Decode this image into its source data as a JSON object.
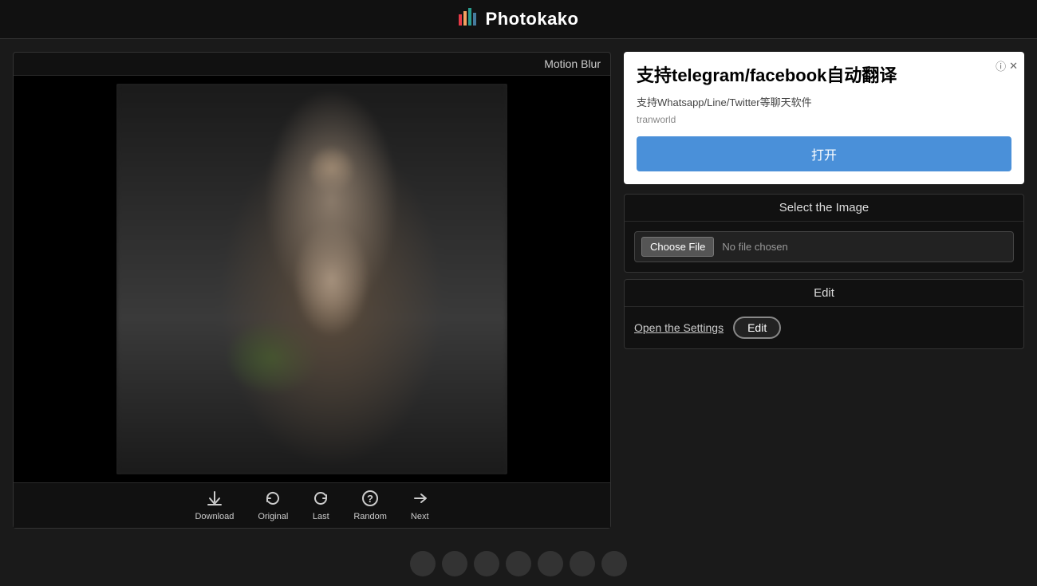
{
  "header": {
    "logo_icon": "📊",
    "site_title": "Photokako"
  },
  "panel": {
    "title": "Motion Blur"
  },
  "toolbar": {
    "items": [
      {
        "icon": "⬇",
        "label": "Download"
      },
      {
        "icon": "↺",
        "label": "Original"
      },
      {
        "icon": "↻",
        "label": "Last"
      },
      {
        "icon": "?",
        "label": "Random"
      },
      {
        "icon": "→",
        "label": "Next"
      }
    ]
  },
  "ad": {
    "title": "支持telegram/facebook自动翻译",
    "subtitle": "支持Whatsapp/Line/Twitter等聊天软件",
    "source": "tranworld",
    "button_label": "打开",
    "info_icon": "ⓘ",
    "close_icon": "✕"
  },
  "select_image": {
    "header": "Select the Image",
    "choose_file_label": "Choose File",
    "file_status": "No file chosen"
  },
  "edit": {
    "header": "Edit",
    "open_settings_label": "Open the Settings",
    "edit_button_label": "Edit"
  }
}
